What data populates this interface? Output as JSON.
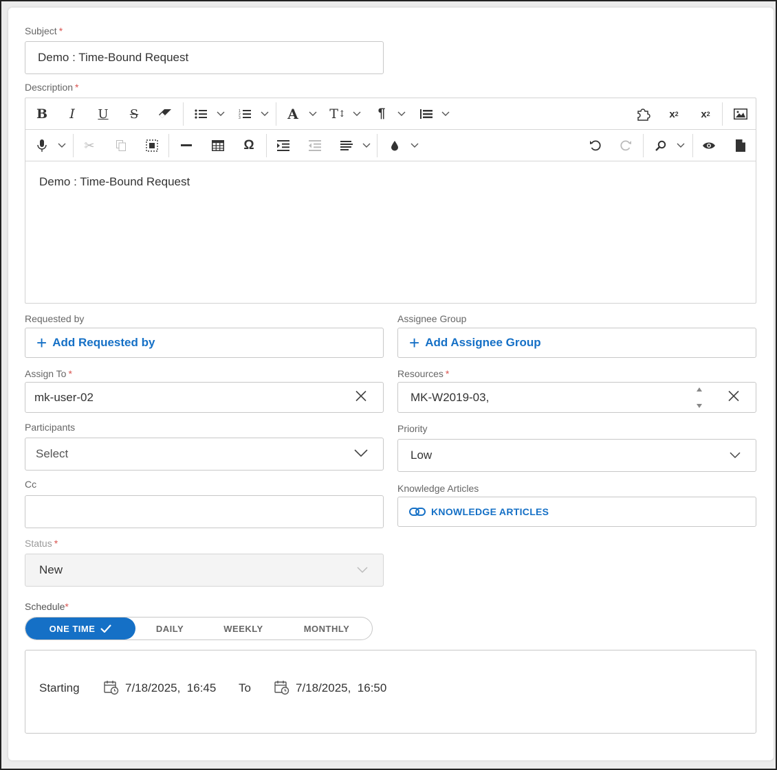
{
  "form": {
    "subject": {
      "label": "Subject",
      "required": "*",
      "value": "Demo : Time-Bound Request"
    },
    "description": {
      "label": "Description",
      "required": "*",
      "body": "Demo : Time-Bound Request"
    },
    "requested_by": {
      "label": "Requested by",
      "button": "Add Requested by"
    },
    "assignee_group": {
      "label": "Assignee Group",
      "button": "Add Assignee Group"
    },
    "assign_to": {
      "label": "Assign To",
      "required": "*",
      "value": "mk-user-02"
    },
    "resources": {
      "label": "Resources",
      "required": "*",
      "value": "MK-W2019-03,"
    },
    "participants": {
      "label": "Participants",
      "placeholder": "Select"
    },
    "priority": {
      "label": "Priority",
      "value": "Low"
    },
    "cc": {
      "label": "Cc",
      "value": ""
    },
    "knowledge_articles": {
      "label": "Knowledge Articles",
      "button": "KNOWLEDGE ARTICLES"
    },
    "status": {
      "label": "Status",
      "required": "*",
      "value": "New"
    },
    "schedule": {
      "label": "Schedule",
      "required": "*",
      "options": [
        "ONE TIME",
        "DAILY",
        "WEEKLY",
        "MONTHLY"
      ],
      "selected": "ONE TIME",
      "starting_label": "Starting",
      "start_value": "7/18/2025,  16:45",
      "to_label": "To",
      "end_value": "7/18/2025,  16:50"
    }
  },
  "toolbar": {
    "row1": [
      "bold-icon",
      "italic-icon",
      "underline-icon",
      "strikethrough-icon",
      "eraser-icon",
      "bullet-list-icon",
      "numbered-list-icon",
      "font-color-icon",
      "font-size-icon",
      "paragraph-icon",
      "line-height-icon",
      "plugin-icon",
      "superscript-icon",
      "subscript-icon",
      "image-icon"
    ],
    "row2": [
      "microphone-icon",
      "cut-icon",
      "copy-icon",
      "select-all-icon",
      "horizontal-rule-icon",
      "table-icon",
      "special-char-icon",
      "indent-icon",
      "outdent-icon",
      "align-icon",
      "color-drop-icon",
      "undo-icon",
      "redo-icon",
      "find-icon",
      "preview-icon",
      "document-icon"
    ]
  },
  "colors": {
    "accent": "#1570c6",
    "required": "#d9534f",
    "border": "#c7c7c7"
  }
}
